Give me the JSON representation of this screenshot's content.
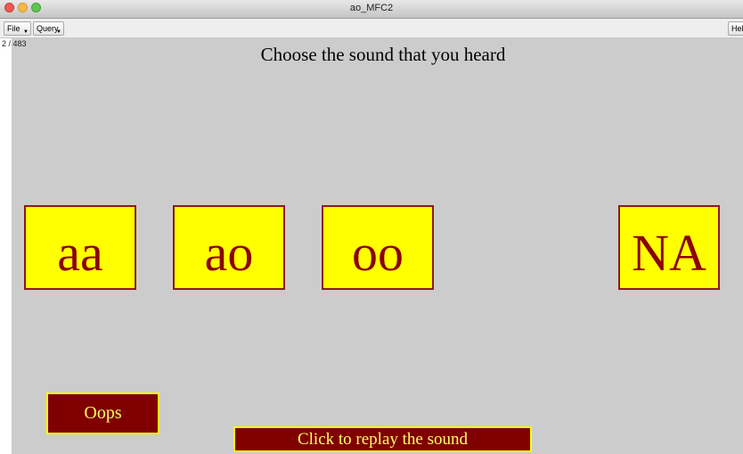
{
  "window": {
    "title": "ao_MFC2"
  },
  "menubar": {
    "file_label": "File",
    "query_label": "Query",
    "help_label": "Help"
  },
  "progress": {
    "counter": "2 / 483"
  },
  "prompt": "Choose the sound that you heard",
  "choices": [
    {
      "label": "aa"
    },
    {
      "label": "ao"
    },
    {
      "label": "oo"
    },
    {
      "label": "NA"
    }
  ],
  "buttons": {
    "oops_label": "Oops",
    "replay_label": "Click to replay the sound"
  },
  "colors": {
    "choice_fill": "#ffff00",
    "choice_text": "#8b0000",
    "button_fill": "#800000",
    "button_text": "#ffff66",
    "background": "#cccccc"
  }
}
